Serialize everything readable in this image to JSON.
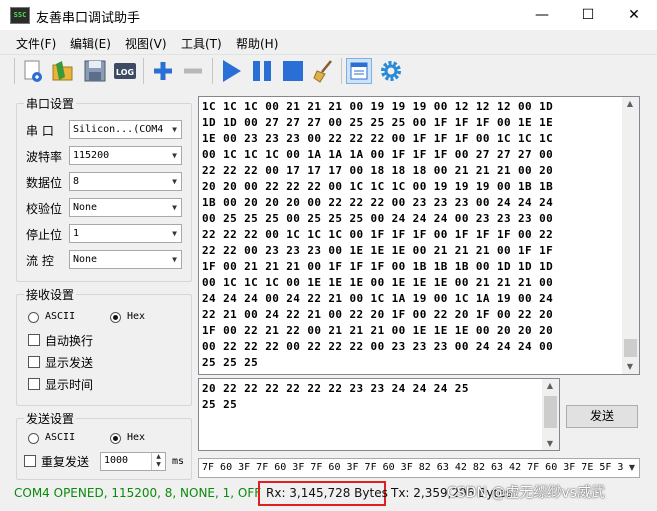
{
  "window": {
    "title": "友善串口调试助手",
    "icon_label": "SSC",
    "controls": [
      "—",
      "☐",
      "✕"
    ]
  },
  "menu": [
    "文件(F)",
    "编辑(E)",
    "视图(V)",
    "工具(T)",
    "帮助(H)"
  ],
  "toolbar": {
    "log_label": "LOG",
    "icons": [
      "new-icon",
      "open-icon",
      "save-icon",
      "log-icon",
      "add-icon",
      "remove-icon",
      "start-icon",
      "pause-icon",
      "stop-icon",
      "clear-icon",
      "window-icon",
      "settings-icon"
    ]
  },
  "serial": {
    "group_label": "串口设置",
    "port_label": "串  口",
    "port_value": "Silicon...(COM4",
    "baud_label": "波特率",
    "baud_value": "115200",
    "databits_label": "数据位",
    "databits_value": "8",
    "parity_label": "校验位",
    "parity_value": "None",
    "stopbits_label": "停止位",
    "stopbits_value": "1",
    "flow_label": "流  控",
    "flow_value": "None"
  },
  "receive": {
    "group_label": "接收设置",
    "ascii_label": "ASCII",
    "hex_label": "Hex",
    "mode_selected": "Hex",
    "auto_wrap_label": "自动换行",
    "show_send_label": "显示发送",
    "show_time_label": "显示时间"
  },
  "send": {
    "group_label": "发送设置",
    "ascii_label": "ASCII",
    "hex_label": "Hex",
    "mode_selected": "Hex",
    "repeat_label": "重复发送",
    "interval_value": "1000",
    "unit_label": "ms",
    "button_label": "发送"
  },
  "receive_lines": [
    "1C 1C 1C 00 21 21 21 00 19 19 19 00 12 12 12 00 1D",
    "1D 1D 00 27 27 27 00 25 25 25 00 1F 1F 1F 00 1E 1E",
    "1E 00 23 23 23 00 22 22 22 00 1F 1F 1F 00 1C 1C 1C",
    "00 1C 1C 1C 00 1A 1A 1A 00 1F 1F 1F 00 27 27 27 00",
    "22 22 22 00 17 17 17 00 18 18 18 00 21 21 21 00 20",
    "20 20 00 22 22 22 00 1C 1C 1C 00 19 19 19 00 1B 1B",
    "1B 00 20 20 20 00 22 22 22 00 23 23 23 00 24 24 24",
    "00 25 25 25 00 25 25 25 00 24 24 24 00 23 23 23 00",
    "22 22 22 00 1C 1C 1C 00 1F 1F 1F 00 1F 1F 1F 00 22",
    "22 22 00 23 23 23 00 1E 1E 1E 00 21 21 21 00 1F 1F",
    "1F 00 21 21 21 00 1F 1F 1F 00 1B 1B 1B 00 1D 1D 1D",
    "00 1C 1C 1C 00 1E 1E 1E 00 1E 1E 1E 00 21 21 21 00",
    "24 24 24 00 24 22 21 00 1C 1A 19 00 1C 1A 19 00 24",
    "22 21 00 24 22 21 00 22 20 1F 00 22 20 1F 00 22 20",
    "1F 00 22 21 22 00 21 21 21 00 1E 1E 1E 00 20 20 20",
    "00 22 22 22 00 22 22 22 00 23 23 23 00 24 24 24 00",
    "25 25 25"
  ],
  "send_lines": [
    "20 22 22 22 22 22 22 23 23 24 24 24 25",
    "25 25"
  ],
  "history_value": "7F 60 3F 7F 60 3F 7F 60 3F 7F 60 3F 82 63 42 82 63 42 7F 60 3F 7E 5F 3",
  "status": {
    "connection": "COM4 OPENED, 115200, 8, NONE, 1, OFF",
    "rx": "Rx: 3,145,728 Bytes",
    "tx": "Tx: 2,359,296 Bytes",
    "watermark": "CSDN @虚无缥缈vs威武"
  },
  "colors": {
    "highlight_box": "#e02020",
    "status_text": "#0a8a0a",
    "toolbar_blue": "#2a6fd6"
  }
}
